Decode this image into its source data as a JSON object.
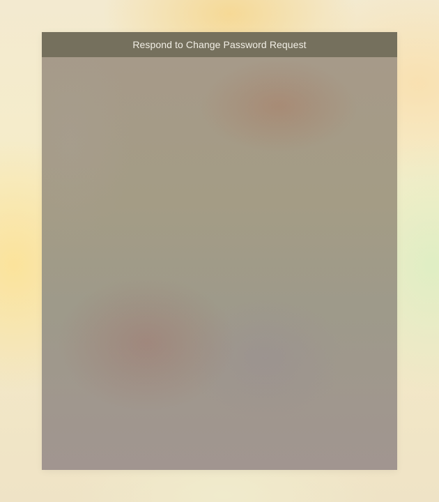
{
  "window": {
    "title": "Respond to Change Password Request"
  },
  "colors": {
    "titlebar": "#75705d",
    "title_text": "#f2efe6",
    "content": "#a49c8a"
  }
}
